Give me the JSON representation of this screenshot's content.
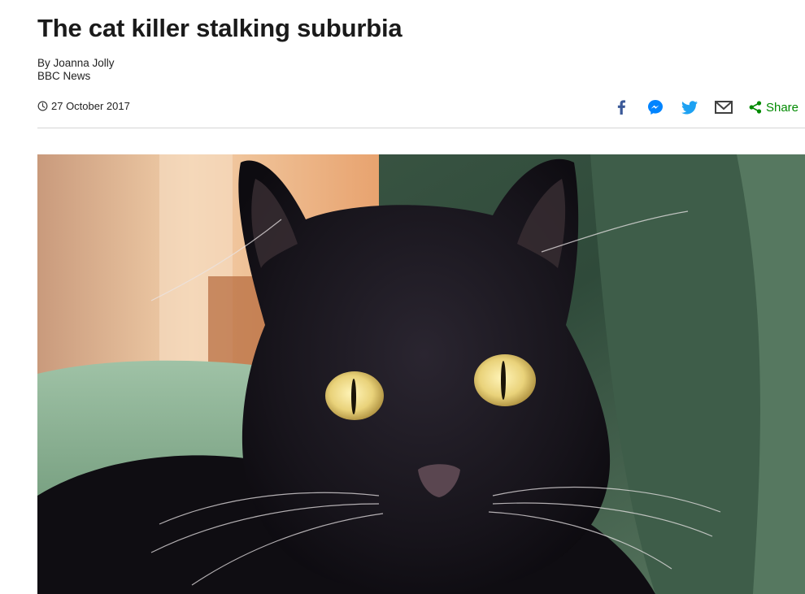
{
  "article": {
    "headline": "The cat killer stalking suburbia",
    "byline_author": "By Joanna Jolly",
    "byline_org": "BBC News",
    "date": "27 October 2017"
  },
  "share": {
    "label": "Share",
    "icons": [
      "facebook-icon",
      "messenger-icon",
      "twitter-icon",
      "email-icon",
      "share-icon"
    ]
  },
  "colors": {
    "facebook": "#3b5998",
    "messenger": "#0084ff",
    "twitter": "#1da1f2",
    "email": "#404040",
    "share": "#008a00"
  },
  "image": {
    "subject": "black cat with yellow eyes on a green armchair"
  }
}
